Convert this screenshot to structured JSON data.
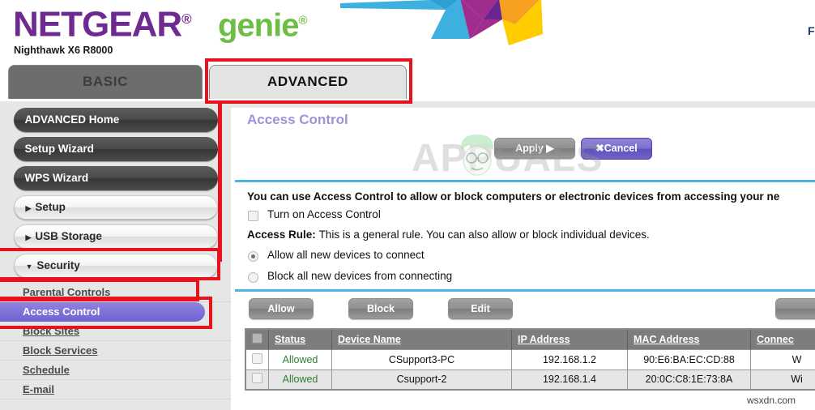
{
  "brand": {
    "netgear": "NETGEAR",
    "reg_mark": "®",
    "genie": "genie",
    "model": "Nighthawk X6 R8000",
    "netgear_color": "#6f2a91",
    "genie_color": "#6cbe45"
  },
  "corner": {
    "cut_label": "F",
    "input_value": ""
  },
  "tabs": [
    {
      "id": "basic",
      "label": "BASIC",
      "selected": false
    },
    {
      "id": "advanced",
      "label": "ADVANCED",
      "selected": true
    }
  ],
  "sidebar": {
    "buttons": [
      {
        "id": "advanced-home",
        "label": "ADVANCED Home",
        "style": "dark"
      },
      {
        "id": "setup-wizard",
        "label": "Setup Wizard",
        "style": "dark"
      },
      {
        "id": "wps-wizard",
        "label": "WPS Wizard",
        "style": "dark"
      }
    ],
    "groups": [
      {
        "id": "setup",
        "label": "Setup",
        "caret": "▶",
        "expanded": false
      },
      {
        "id": "usb-storage",
        "label": "USB Storage",
        "caret": "▶",
        "expanded": false
      },
      {
        "id": "security",
        "label": "Security",
        "caret": "▼",
        "expanded": true
      }
    ],
    "security_items": [
      {
        "id": "parental-controls",
        "label": "Parental Controls",
        "active": false
      },
      {
        "id": "access-control",
        "label": "Access Control",
        "active": true
      },
      {
        "id": "block-sites",
        "label": "Block Sites",
        "active": false
      },
      {
        "id": "block-services",
        "label": "Block Services",
        "active": false
      },
      {
        "id": "schedule",
        "label": "Schedule",
        "active": false
      },
      {
        "id": "e-mail",
        "label": "E-mail",
        "active": false
      }
    ]
  },
  "main": {
    "page_title": "Access Control",
    "title_color": "#9b93d6",
    "apply_label": "Apply",
    "apply_arrow": "▶",
    "cancel_label": "Cancel",
    "cancel_icon": "✖",
    "description": "You can use Access Control to allow or block computers or electronic devices from accessing your ne",
    "turn_on_label": "Turn on Access Control",
    "turn_on_checked": false,
    "access_rule_label": "Access Rule:",
    "access_rule_text": "This is a general rule. You can also allow or block individual devices.",
    "radios": [
      {
        "id": "allow-all",
        "label": "Allow all new devices to connect",
        "selected": true
      },
      {
        "id": "block-all",
        "label": "Block all new devices from connecting",
        "selected": false
      }
    ],
    "table_buttons": [
      {
        "id": "allow",
        "label": "Allow"
      },
      {
        "id": "block",
        "label": "Block"
      },
      {
        "id": "edit",
        "label": "Edit"
      }
    ],
    "table": {
      "headers": [
        "",
        "Status",
        "Device Name",
        "IP Address",
        "MAC Address",
        "Connec"
      ],
      "rows": [
        {
          "status": "Allowed",
          "device_name": "CSupport3-PC",
          "ip_address": "192.168.1.2",
          "mac_address": "90:E6:BA:EC:CD:88",
          "connection": "W"
        },
        {
          "status": "Allowed",
          "device_name": "Csupport-2",
          "ip_address": "192.168.1.4",
          "mac_address": "20:0C:C8:1E:73:8A",
          "connection": "Wi"
        }
      ]
    }
  },
  "watermarks": {
    "overlay": "APPUALS",
    "bottom": "wsxdn.com"
  },
  "annotations": {
    "highlight_color": "#e8121e"
  }
}
